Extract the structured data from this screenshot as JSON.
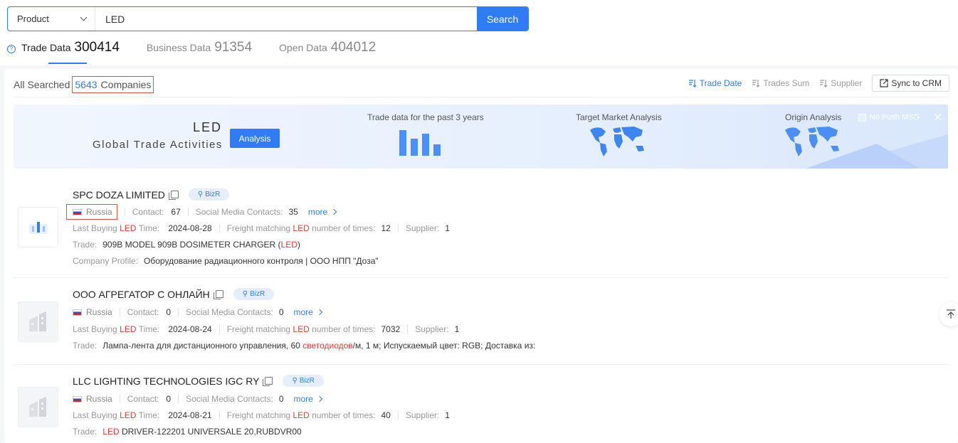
{
  "search": {
    "type_value": "Product",
    "query": "LED",
    "button_label": "Search"
  },
  "tabs": [
    {
      "label": "Trade Data",
      "count": "300414",
      "active": true
    },
    {
      "label": "Business Data",
      "count": "91354",
      "active": false
    },
    {
      "label": "Open Data",
      "count": "404012",
      "active": false
    }
  ],
  "summary": {
    "prefix": "All Searched",
    "count": "5643",
    "suffix": "Companies"
  },
  "sort": {
    "trade_date": "Trade Date",
    "trades_sum": "Trades Sum",
    "supplier": "Supplier",
    "sync": "Sync to CRM"
  },
  "banner": {
    "word": "LED",
    "subtitle": "Global Trade Activities",
    "analysis_label": "Analysis",
    "cap_trade": "Trade data for the past 3 years",
    "cap_target": "Target Market Analysis",
    "cap_origin": "Origin Analysis",
    "no_push": "No Push MSG",
    "accent": "#2f7cf6"
  },
  "labels": {
    "contact": "Contact:",
    "social": "Social Media Contacts:",
    "more": "more",
    "last_buying": "Last Buying",
    "time": "Time:",
    "freight": "Freight matching",
    "times": "number of times:",
    "supplier": "Supplier:",
    "trade": "Trade:",
    "profile": "Company Profile:",
    "keyword": "LED",
    "bizr": "BizR"
  },
  "companies": [
    {
      "name": "SPC DOZA LIMITED",
      "country": "Russia",
      "contact": "67",
      "social": "35",
      "last_time": "2024-08-28",
      "freight_times": "12",
      "supplier": "1",
      "trade_pre": "909B MODEL 909B DOSIMETER CHARGER (",
      "trade_hl": "LED",
      "trade_post": ")",
      "profile": "Оборудование радиационного контроля | ООО НПП \"Доза\""
    },
    {
      "name": "ООО АГРЕГАТОР С ОНЛАЙН",
      "country": "Russia",
      "contact": "0",
      "social": "0",
      "last_time": "2024-08-24",
      "freight_times": "7032",
      "supplier": "1",
      "trade_pre": "Лампа-лента для дистанционного управления, 60 ",
      "trade_hl": "светодиодов",
      "trade_post": "/м, 1 м; Испускаемый цвет: RGB; Доставка из:"
    },
    {
      "name": "LLC LIGHTING TECHNOLOGIES IGC RY",
      "country": "Russia",
      "contact": "0",
      "social": "0",
      "last_time": "2024-08-21",
      "freight_times": "40",
      "supplier": "1",
      "trade_pre": "",
      "trade_hl": "LED",
      "trade_post": "DRIVER-122201 UNIVERSALE 20,RUBDVR00"
    }
  ]
}
